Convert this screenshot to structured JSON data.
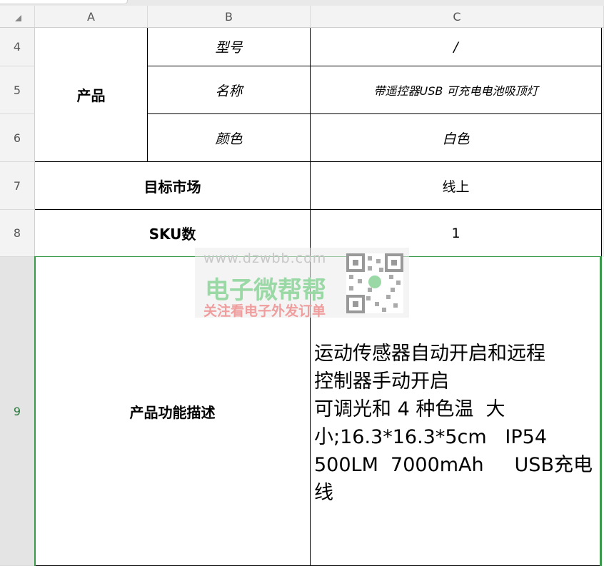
{
  "columns": [
    "A",
    "B",
    "C"
  ],
  "rows": [
    "4",
    "5",
    "6",
    "7",
    "8",
    "9"
  ],
  "cells": {
    "product": "产品",
    "model_label": "型号",
    "model_value": "/",
    "name_label": "名称",
    "name_value": "带遥控器USB 可充电电池吸顶灯",
    "color_label": "颜色",
    "color_value": "白色",
    "market_label": "目标市场",
    "market_value": "线上",
    "sku_label": "SKU数",
    "sku_value": "1",
    "desc_label": "产品功能描述",
    "desc_value": "运动传感器自动开启和远程\n控制器手动开启\n可调光和 4 种色温  大\n小;16.3*16.3*5cm   IP54\n500LM  7000mAh     USB充电\n线"
  },
  "watermark": {
    "url": "www.dzwbb.com",
    "title": "电子微帮帮",
    "subtitle": "关注看电子外发订单"
  },
  "selection_color": "#3a9a4a"
}
